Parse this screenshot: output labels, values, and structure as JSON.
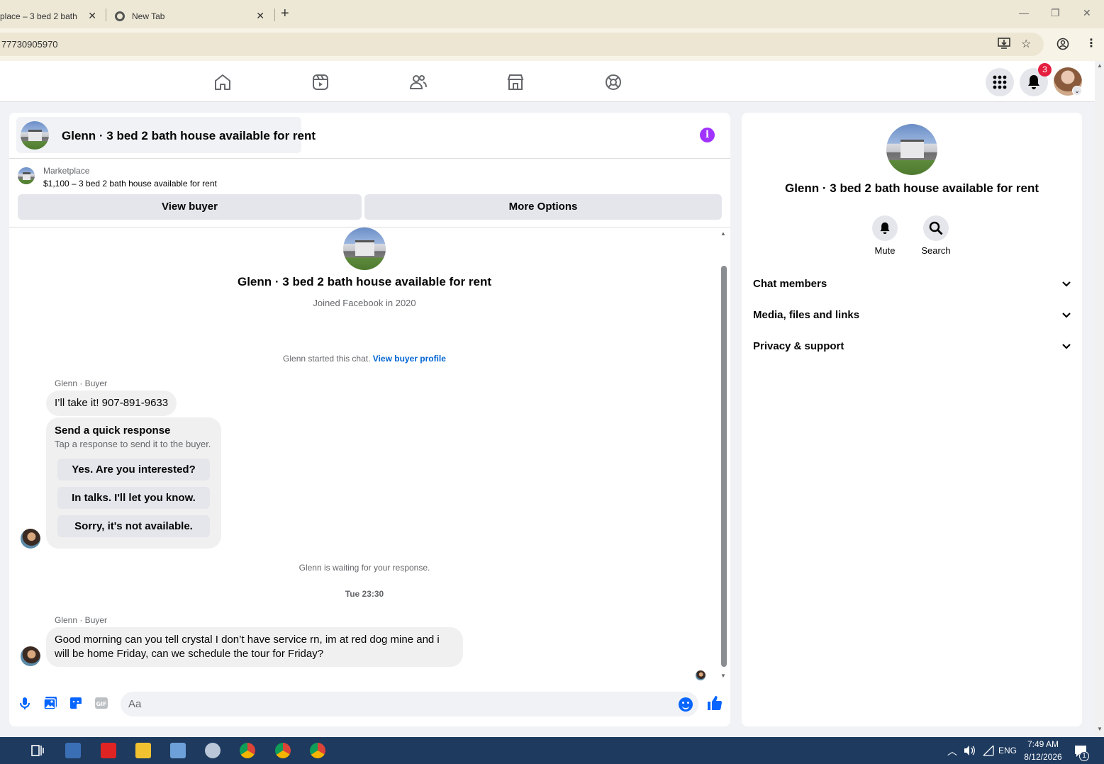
{
  "browser": {
    "tabs": [
      {
        "label": "place – 3 bed 2 bath h"
      },
      {
        "label": "New Tab"
      }
    ],
    "address": "77730905970"
  },
  "fb_header": {
    "notification_count": "3"
  },
  "chat": {
    "title": "Glenn · 3 bed 2 bath house available for rent",
    "marketplace_label": "Marketplace",
    "listing": "$1,100 – 3 bed 2 bath house available for rent",
    "view_buyer_label": "View buyer",
    "more_options_label": "More Options",
    "intro_name": "Glenn · 3 bed 2 bath house available for rent",
    "joined": "Joined Facebook in 2020",
    "started_text": "Glenn started this chat.",
    "view_buyer_profile": "View buyer profile",
    "messages": [
      {
        "sender": "Glenn · Buyer",
        "text": "I’ll take it! 907-891-9633"
      },
      {
        "sender": "Glenn · Buyer",
        "text": "Good morning can you tell crystal I don’t have service rn, im at red dog mine and i will be home Friday, can we schedule the tour for Friday?"
      }
    ],
    "quick_response": {
      "title": "Send a quick response",
      "subtitle": "Tap a response to send it to the buyer.",
      "options": [
        "Yes. Are you interested?",
        "In talks. I'll let you know.",
        "Sorry, it's not available."
      ]
    },
    "waiting_text": "Glenn is waiting for your response.",
    "timestamp": "Tue 23:30",
    "composer_placeholder": "Aa"
  },
  "right_panel": {
    "title": "Glenn · 3 bed 2 bath house available for rent",
    "mute_label": "Mute",
    "search_label": "Search",
    "sections": [
      "Chat members",
      "Media, files and links",
      "Privacy & support"
    ]
  },
  "taskbar": {
    "language": "ENG",
    "time": "7:49 AM",
    "date": "8/12/2026",
    "notif_count": "1"
  },
  "colors": {
    "messenger_blue": "#0866ff",
    "info_purple": "#a033ff",
    "badge_red": "#e41e3f"
  }
}
